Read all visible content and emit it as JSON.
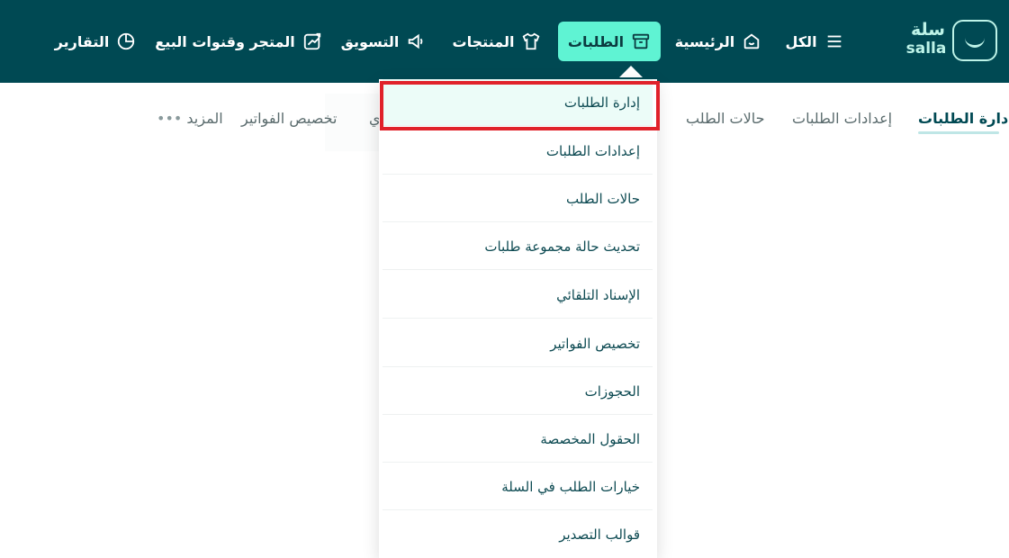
{
  "brand": {
    "name_ar": "سلة",
    "name_en": "salla",
    "icon": "salla-bag-icon"
  },
  "nav": [
    {
      "key": "all",
      "label": "الكل",
      "icon": "menu-icon"
    },
    {
      "key": "home",
      "label": "الرئيسية",
      "icon": "home-icon"
    },
    {
      "key": "orders",
      "label": "الطلبات",
      "icon": "archive-box-icon",
      "active": true
    },
    {
      "key": "products",
      "label": "المنتجات",
      "icon": "tshirt-icon"
    },
    {
      "key": "marketing",
      "label": "التسويق",
      "icon": "megaphone-icon"
    },
    {
      "key": "store",
      "label": "المتجر وقنوات البيع",
      "icon": "store-channels-icon"
    },
    {
      "key": "reports",
      "label": "التقارير",
      "icon": "pie-chart-icon"
    }
  ],
  "subnav": [
    {
      "label": "إدارة الطلبات",
      "active": true
    },
    {
      "label": "إعدادات الطلبات"
    },
    {
      "label": "حالات الطلب"
    },
    {
      "label": "ي"
    },
    {
      "label": "تخصيص الفواتير"
    },
    {
      "label": "المزيد",
      "icon": "more-dots-icon"
    }
  ],
  "dropdown": [
    {
      "label": "إدارة الطلبات",
      "highlighted": true
    },
    {
      "label": "إعدادات الطلبات"
    },
    {
      "label": "حالات الطلب"
    },
    {
      "label": "تحديث حالة مجموعة طلبات"
    },
    {
      "label": "الإسناد التلقائي"
    },
    {
      "label": "تخصيص الفواتير"
    },
    {
      "label": "الحجوزات"
    },
    {
      "label": "الحقول المخصصة"
    },
    {
      "label": "خيارات الطلب في السلة"
    },
    {
      "label": "قوالب التصدير"
    }
  ],
  "colors": {
    "topbar": "#004953",
    "active_tab": "#5ff3d3",
    "highlight_border": "#e0222a"
  }
}
